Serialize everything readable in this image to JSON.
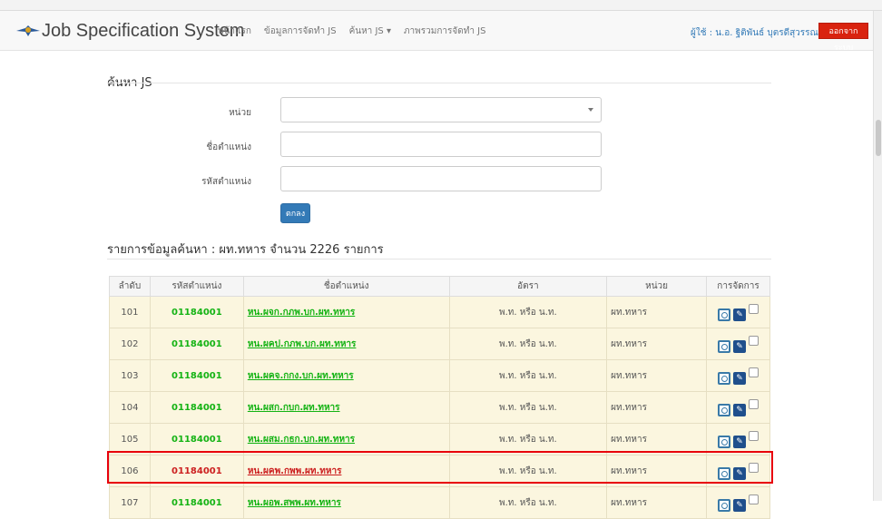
{
  "nav": {
    "brand": "Job Specification System",
    "links": [
      "หน้าแรก",
      "ข้อมูลการจัดทำ JS",
      "ค้นหา JS ▾",
      "ภาพรวมการจัดทำ JS"
    ],
    "user": "ผู้ใช้ : น.อ. ฐิติพันธ์ บุตรดีสุวรรณ",
    "logout": "ออกจากระบบ"
  },
  "search": {
    "title": "ค้นหา JS",
    "unit_label": "หน่วย",
    "position_name_label": "ชื่อตำแหน่ง",
    "position_code_label": "รหัสตำแหน่ง",
    "submit": "ตกลง"
  },
  "results": {
    "title": "รายการข้อมูลค้นหา : ผท.ทหาร จำนวน 2226 รายการ",
    "headers": [
      "ลำดับ",
      "รหัสตำแหน่ง",
      "ชื่อตำแหน่ง",
      "อัตรา",
      "หน่วย",
      "การจัดการ"
    ],
    "rows": [
      {
        "no": "101",
        "code": "01184001",
        "name": "หน.ผจก.กภพ.บก.ผท.ทหาร",
        "rate": "พ.ท. หรือ น.ท.",
        "unit": "ผท.ทหาร"
      },
      {
        "no": "102",
        "code": "01184001",
        "name": "หน.ผคป.กภพ.บก.ผท.ทหาร",
        "rate": "พ.ท. หรือ น.ท.",
        "unit": "ผท.ทหาร"
      },
      {
        "no": "103",
        "code": "01184001",
        "name": "หน.ผคจ.กกง.บก.ผท.ทหาร",
        "rate": "พ.ท. หรือ น.ท.",
        "unit": "ผท.ทหาร"
      },
      {
        "no": "104",
        "code": "01184001",
        "name": "หน.ผสก.กบก.ผท.ทหาร",
        "rate": "พ.ท. หรือ น.ท.",
        "unit": "ผท.ทหาร"
      },
      {
        "no": "105",
        "code": "01184001",
        "name": "หน.ผสม.กธก.บก.ผท.ทหาร",
        "rate": "พ.ท. หรือ น.ท.",
        "unit": "ผท.ทหาร"
      },
      {
        "no": "106",
        "code": "01184001",
        "name": "หน.ผคพ.กพพ.ผท.ทหาร",
        "rate": "พ.ท. หรือ น.ท.",
        "unit": "ผท.ทหาร"
      },
      {
        "no": "107",
        "code": "01184001",
        "name": "หน.ผอพ.สพพ.ผท.ทหาร",
        "rate": "พ.ท. หรือ น.ท.",
        "unit": "ผท.ทหาร"
      }
    ]
  },
  "colors": {
    "accent": "#337ab7",
    "logout": "#d9230f",
    "link_green": "#14b314",
    "highlight": "#e8000b"
  }
}
